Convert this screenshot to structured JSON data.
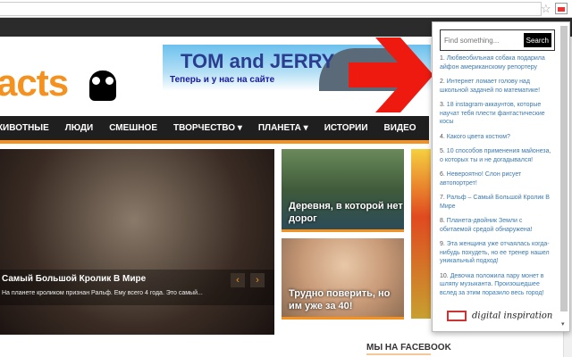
{
  "browser": {
    "star_icon": "star-icon",
    "extension_icon": "digital-inspiration-extension-icon"
  },
  "header": {
    "logo_text": "acts",
    "banner_title": "TOM and JERRY",
    "banner_subtitle": "Теперь и у нас на сайте"
  },
  "nav": [
    "ЖИВОТНЫЕ",
    "ЛЮДИ",
    "СМЕШНОЕ",
    "ТВОРЧЕСТВО ▾",
    "ПЛАНЕТА ▾",
    "ИСТОРИИ",
    "ВИДЕО"
  ],
  "hero": {
    "title": "Самый Большой Кролик В Мире",
    "excerpt": "На планете кроликом признан Ральф. Ему всего 4 года. Это самый...",
    "prev": "‹",
    "next": "›"
  },
  "tiles": [
    {
      "title": "Деревня, в которой нет дорог"
    },
    {
      "title": "Трудно поверить, но им уже за 40!"
    }
  ],
  "sidebar": {
    "facebook_heading": "МЫ НА FACEBOOK"
  },
  "popup": {
    "search_placeholder": "Find something...",
    "search_button": "Search",
    "items": [
      {
        "num": "1.",
        "title": "Любвеобильная собака подарила айфон американскому репортеру"
      },
      {
        "num": "2.",
        "title": "Интернет ломает голову над школьной задачей по математике!"
      },
      {
        "num": "3.",
        "title": "18 instagram-аккаунтов, которые научат тебя плести фантастические косы"
      },
      {
        "num": "4.",
        "title": "Какого цвета костюм?"
      },
      {
        "num": "5.",
        "title": "10 способов применения майонеза, о которых ты и не догадывался!"
      },
      {
        "num": "6.",
        "title": "Невероятно! Слон рисует автопортрет!"
      },
      {
        "num": "7.",
        "title": "Ральф – Самый Большой Кролик В Мире"
      },
      {
        "num": "8.",
        "title": "Планета-двойник Земли с обитаемой средой обнаружена!"
      },
      {
        "num": "9.",
        "title": "Эта женщина уже отчаялась когда-нибудь похудеть, но ее тренер нашел уникальный подход!"
      },
      {
        "num": "10.",
        "title": "Девочка положила пару монет в шляпу музыканта. Произошедшее вслед за этим поразило весь город!"
      }
    ],
    "brand": "digital inspiration"
  }
}
